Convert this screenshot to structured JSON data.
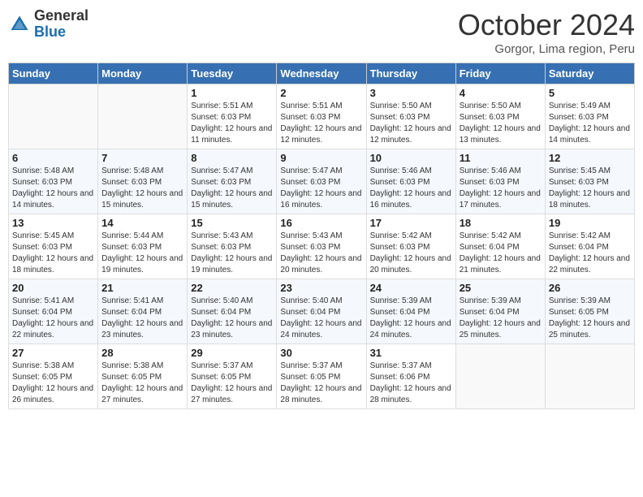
{
  "logo": {
    "general": "General",
    "blue": "Blue"
  },
  "header": {
    "month": "October 2024",
    "location": "Gorgor, Lima region, Peru"
  },
  "weekdays": [
    "Sunday",
    "Monday",
    "Tuesday",
    "Wednesday",
    "Thursday",
    "Friday",
    "Saturday"
  ],
  "weeks": [
    [
      {
        "day": "",
        "info": ""
      },
      {
        "day": "",
        "info": ""
      },
      {
        "day": "1",
        "info": "Sunrise: 5:51 AM\nSunset: 6:03 PM\nDaylight: 12 hours and 11 minutes."
      },
      {
        "day": "2",
        "info": "Sunrise: 5:51 AM\nSunset: 6:03 PM\nDaylight: 12 hours and 12 minutes."
      },
      {
        "day": "3",
        "info": "Sunrise: 5:50 AM\nSunset: 6:03 PM\nDaylight: 12 hours and 12 minutes."
      },
      {
        "day": "4",
        "info": "Sunrise: 5:50 AM\nSunset: 6:03 PM\nDaylight: 12 hours and 13 minutes."
      },
      {
        "day": "5",
        "info": "Sunrise: 5:49 AM\nSunset: 6:03 PM\nDaylight: 12 hours and 14 minutes."
      }
    ],
    [
      {
        "day": "6",
        "info": "Sunrise: 5:48 AM\nSunset: 6:03 PM\nDaylight: 12 hours and 14 minutes."
      },
      {
        "day": "7",
        "info": "Sunrise: 5:48 AM\nSunset: 6:03 PM\nDaylight: 12 hours and 15 minutes."
      },
      {
        "day": "8",
        "info": "Sunrise: 5:47 AM\nSunset: 6:03 PM\nDaylight: 12 hours and 15 minutes."
      },
      {
        "day": "9",
        "info": "Sunrise: 5:47 AM\nSunset: 6:03 PM\nDaylight: 12 hours and 16 minutes."
      },
      {
        "day": "10",
        "info": "Sunrise: 5:46 AM\nSunset: 6:03 PM\nDaylight: 12 hours and 16 minutes."
      },
      {
        "day": "11",
        "info": "Sunrise: 5:46 AM\nSunset: 6:03 PM\nDaylight: 12 hours and 17 minutes."
      },
      {
        "day": "12",
        "info": "Sunrise: 5:45 AM\nSunset: 6:03 PM\nDaylight: 12 hours and 18 minutes."
      }
    ],
    [
      {
        "day": "13",
        "info": "Sunrise: 5:45 AM\nSunset: 6:03 PM\nDaylight: 12 hours and 18 minutes."
      },
      {
        "day": "14",
        "info": "Sunrise: 5:44 AM\nSunset: 6:03 PM\nDaylight: 12 hours and 19 minutes."
      },
      {
        "day": "15",
        "info": "Sunrise: 5:43 AM\nSunset: 6:03 PM\nDaylight: 12 hours and 19 minutes."
      },
      {
        "day": "16",
        "info": "Sunrise: 5:43 AM\nSunset: 6:03 PM\nDaylight: 12 hours and 20 minutes."
      },
      {
        "day": "17",
        "info": "Sunrise: 5:42 AM\nSunset: 6:03 PM\nDaylight: 12 hours and 20 minutes."
      },
      {
        "day": "18",
        "info": "Sunrise: 5:42 AM\nSunset: 6:04 PM\nDaylight: 12 hours and 21 minutes."
      },
      {
        "day": "19",
        "info": "Sunrise: 5:42 AM\nSunset: 6:04 PM\nDaylight: 12 hours and 22 minutes."
      }
    ],
    [
      {
        "day": "20",
        "info": "Sunrise: 5:41 AM\nSunset: 6:04 PM\nDaylight: 12 hours and 22 minutes."
      },
      {
        "day": "21",
        "info": "Sunrise: 5:41 AM\nSunset: 6:04 PM\nDaylight: 12 hours and 23 minutes."
      },
      {
        "day": "22",
        "info": "Sunrise: 5:40 AM\nSunset: 6:04 PM\nDaylight: 12 hours and 23 minutes."
      },
      {
        "day": "23",
        "info": "Sunrise: 5:40 AM\nSunset: 6:04 PM\nDaylight: 12 hours and 24 minutes."
      },
      {
        "day": "24",
        "info": "Sunrise: 5:39 AM\nSunset: 6:04 PM\nDaylight: 12 hours and 24 minutes."
      },
      {
        "day": "25",
        "info": "Sunrise: 5:39 AM\nSunset: 6:04 PM\nDaylight: 12 hours and 25 minutes."
      },
      {
        "day": "26",
        "info": "Sunrise: 5:39 AM\nSunset: 6:05 PM\nDaylight: 12 hours and 25 minutes."
      }
    ],
    [
      {
        "day": "27",
        "info": "Sunrise: 5:38 AM\nSunset: 6:05 PM\nDaylight: 12 hours and 26 minutes."
      },
      {
        "day": "28",
        "info": "Sunrise: 5:38 AM\nSunset: 6:05 PM\nDaylight: 12 hours and 27 minutes."
      },
      {
        "day": "29",
        "info": "Sunrise: 5:37 AM\nSunset: 6:05 PM\nDaylight: 12 hours and 27 minutes."
      },
      {
        "day": "30",
        "info": "Sunrise: 5:37 AM\nSunset: 6:05 PM\nDaylight: 12 hours and 28 minutes."
      },
      {
        "day": "31",
        "info": "Sunrise: 5:37 AM\nSunset: 6:06 PM\nDaylight: 12 hours and 28 minutes."
      },
      {
        "day": "",
        "info": ""
      },
      {
        "day": "",
        "info": ""
      }
    ]
  ]
}
